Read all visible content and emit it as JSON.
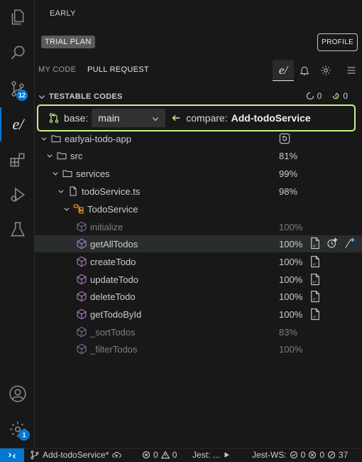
{
  "activity_bar": {
    "items": [
      {
        "name": "explorer-icon"
      },
      {
        "name": "search-icon"
      },
      {
        "name": "source-control-icon",
        "badge": "12"
      },
      {
        "name": "early-ai-icon",
        "label": "e/"
      },
      {
        "name": "extensions-icon"
      },
      {
        "name": "run-debug-icon"
      },
      {
        "name": "testing-icon"
      }
    ],
    "bottom": [
      {
        "name": "account-icon"
      },
      {
        "name": "manage-gear-icon",
        "badge": "1"
      }
    ]
  },
  "panel": {
    "title": "EARLY",
    "trial_label": "TRIAL PLAN",
    "profile_label": "PROFILE",
    "tabs": [
      {
        "label": "MY CODE",
        "active": false
      },
      {
        "label": "PULL REQUEST",
        "active": true
      }
    ],
    "toolbar_logo": "e/",
    "section": {
      "title": "TESTABLE CODES",
      "count_running": "0",
      "count_done": "0"
    },
    "compare": {
      "base_label": "base:",
      "base_value": "main",
      "compare_label": "compare:",
      "compare_value": "Add-todoService"
    },
    "tree": [
      {
        "name": "earlyai-todo-app",
        "pct": "",
        "kind": "folder",
        "dim": false
      },
      {
        "name": "src",
        "pct": "81%",
        "kind": "folder",
        "dim": false
      },
      {
        "name": "services",
        "pct": "99%",
        "kind": "folder",
        "dim": false
      },
      {
        "name": "todoService.ts",
        "pct": "98%",
        "kind": "file",
        "dim": false
      },
      {
        "name": "TodoService",
        "pct": "",
        "kind": "class",
        "dim": false
      },
      {
        "name": "initialize",
        "pct": "100%",
        "kind": "method",
        "dim": true
      },
      {
        "name": "getAllTodos",
        "pct": "100%",
        "kind": "method",
        "dim": false
      },
      {
        "name": "createTodo",
        "pct": "100%",
        "kind": "method",
        "dim": false
      },
      {
        "name": "updateTodo",
        "pct": "100%",
        "kind": "method",
        "dim": false
      },
      {
        "name": "deleteTodo",
        "pct": "100%",
        "kind": "method",
        "dim": false
      },
      {
        "name": "getTodoById",
        "pct": "100%",
        "kind": "method",
        "dim": false
      },
      {
        "name": "_sortTodos",
        "pct": "83%",
        "kind": "method",
        "dim": true
      },
      {
        "name": "_filterTodos",
        "pct": "100%",
        "kind": "method",
        "dim": true
      }
    ]
  },
  "status_bar": {
    "branch": "Add-todoService*",
    "errors": "0",
    "warnings": "0",
    "jest": "Jest: ...",
    "jest_ws": "Jest-WS:",
    "ws_pass": "0",
    "ws_fail": "0",
    "ws_skip": "37"
  },
  "colors": {
    "accent": "#0078d4",
    "compare_border": "#c8f08a",
    "method_icon": "#b180d7",
    "class_icon": "#ee9d28"
  }
}
